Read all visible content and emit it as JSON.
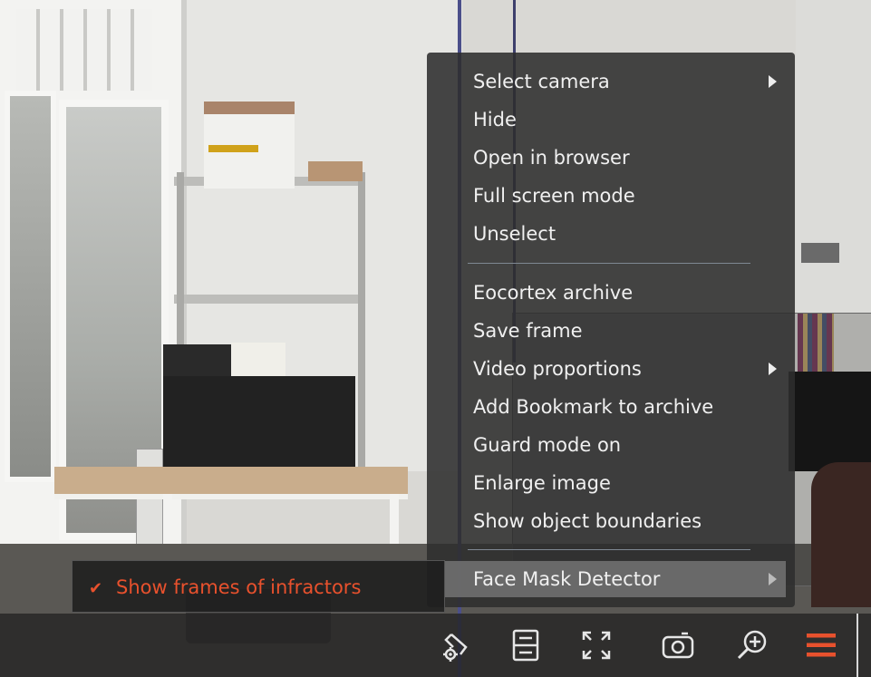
{
  "context_menu": {
    "items": [
      {
        "label": "Select camera",
        "has_submenu": true
      },
      {
        "label": "Hide",
        "has_submenu": false
      },
      {
        "label": "Open in browser",
        "has_submenu": false
      },
      {
        "label": "Full screen mode",
        "has_submenu": false
      },
      {
        "label": "Unselect",
        "has_submenu": false
      },
      {
        "label": "Eocortex archive",
        "has_submenu": false
      },
      {
        "label": "Save frame",
        "has_submenu": false
      },
      {
        "label": "Video proportions",
        "has_submenu": true
      },
      {
        "label": "Add Bookmark to archive",
        "has_submenu": false
      },
      {
        "label": "Guard mode on",
        "has_submenu": false
      },
      {
        "label": "Enlarge image",
        "has_submenu": false
      },
      {
        "label": "Show object boundaries",
        "has_submenu": false
      },
      {
        "label": "Face Mask Detector",
        "has_submenu": true,
        "highlighted": true
      }
    ]
  },
  "submenu": {
    "items": [
      {
        "label": "Show frames of infractors",
        "checked": true
      }
    ]
  },
  "toolbar": {
    "buttons": [
      {
        "icon": "camera-settings-icon"
      },
      {
        "icon": "layout-icon"
      },
      {
        "icon": "fullscreen-icon"
      },
      {
        "icon": "snapshot-camera-icon"
      },
      {
        "icon": "zoom-in-icon"
      },
      {
        "icon": "hamburger-menu-icon"
      }
    ]
  },
  "colors": {
    "accent": "#e8512d",
    "menu_bg": "#2e2e2e",
    "menu_text": "#f0f0f0",
    "highlight_bg": "#737373",
    "separator": "#7f8893"
  }
}
